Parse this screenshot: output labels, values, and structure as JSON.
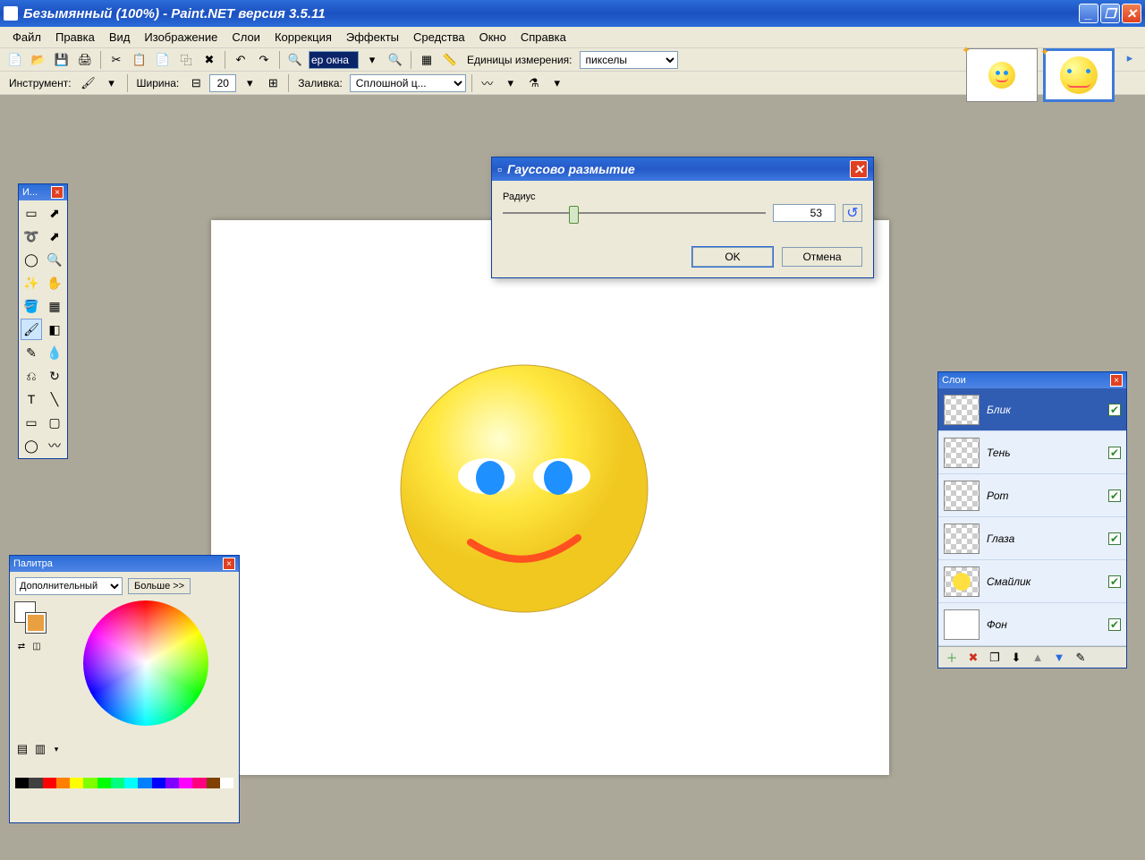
{
  "title": "Безымянный (100%) - Paint.NET версия 3.5.11",
  "menu": [
    "Файл",
    "Правка",
    "Вид",
    "Изображение",
    "Слои",
    "Коррекция",
    "Эффекты",
    "Средства",
    "Окно",
    "Справка"
  ],
  "toolbar1": {
    "zoom_value": "ер окна",
    "units_label": "Единицы измерения:",
    "units_value": "пикселы"
  },
  "toolbar2": {
    "tool_label": "Инструмент:",
    "width_label": "Ширина:",
    "width_value": "20",
    "fill_label": "Заливка:",
    "fill_value": "Сплошной ц..."
  },
  "tools_panel": {
    "title": "И..."
  },
  "palette": {
    "title": "Палитра",
    "mode": "Дополнительный",
    "more": "Больше >>",
    "primary": "#ffffff",
    "secondary": "#e8a040",
    "strip": [
      "#000000",
      "#404040",
      "#ff0000",
      "#ff8000",
      "#ffff00",
      "#80ff00",
      "#00ff00",
      "#00ff80",
      "#00ffff",
      "#0080ff",
      "#0000ff",
      "#8000ff",
      "#ff00ff",
      "#ff0080",
      "#804000",
      "#ffffff"
    ]
  },
  "layers": {
    "title": "Слои",
    "items": [
      {
        "name": "Блик",
        "selected": true,
        "checked": true,
        "thumb": "none"
      },
      {
        "name": "Тень",
        "checked": true,
        "thumb": "none"
      },
      {
        "name": "Рот",
        "checked": true,
        "thumb": "none"
      },
      {
        "name": "Глаза",
        "checked": true,
        "thumb": "none"
      },
      {
        "name": "Смайлик",
        "checked": true,
        "thumb": "circle"
      },
      {
        "name": "Фон",
        "checked": true,
        "thumb": "white"
      }
    ]
  },
  "dialog": {
    "title": "Гауссово размытие",
    "param_label": "Радиус",
    "value": "53",
    "slider_pct": 25,
    "ok": "OK",
    "cancel": "Отмена"
  }
}
